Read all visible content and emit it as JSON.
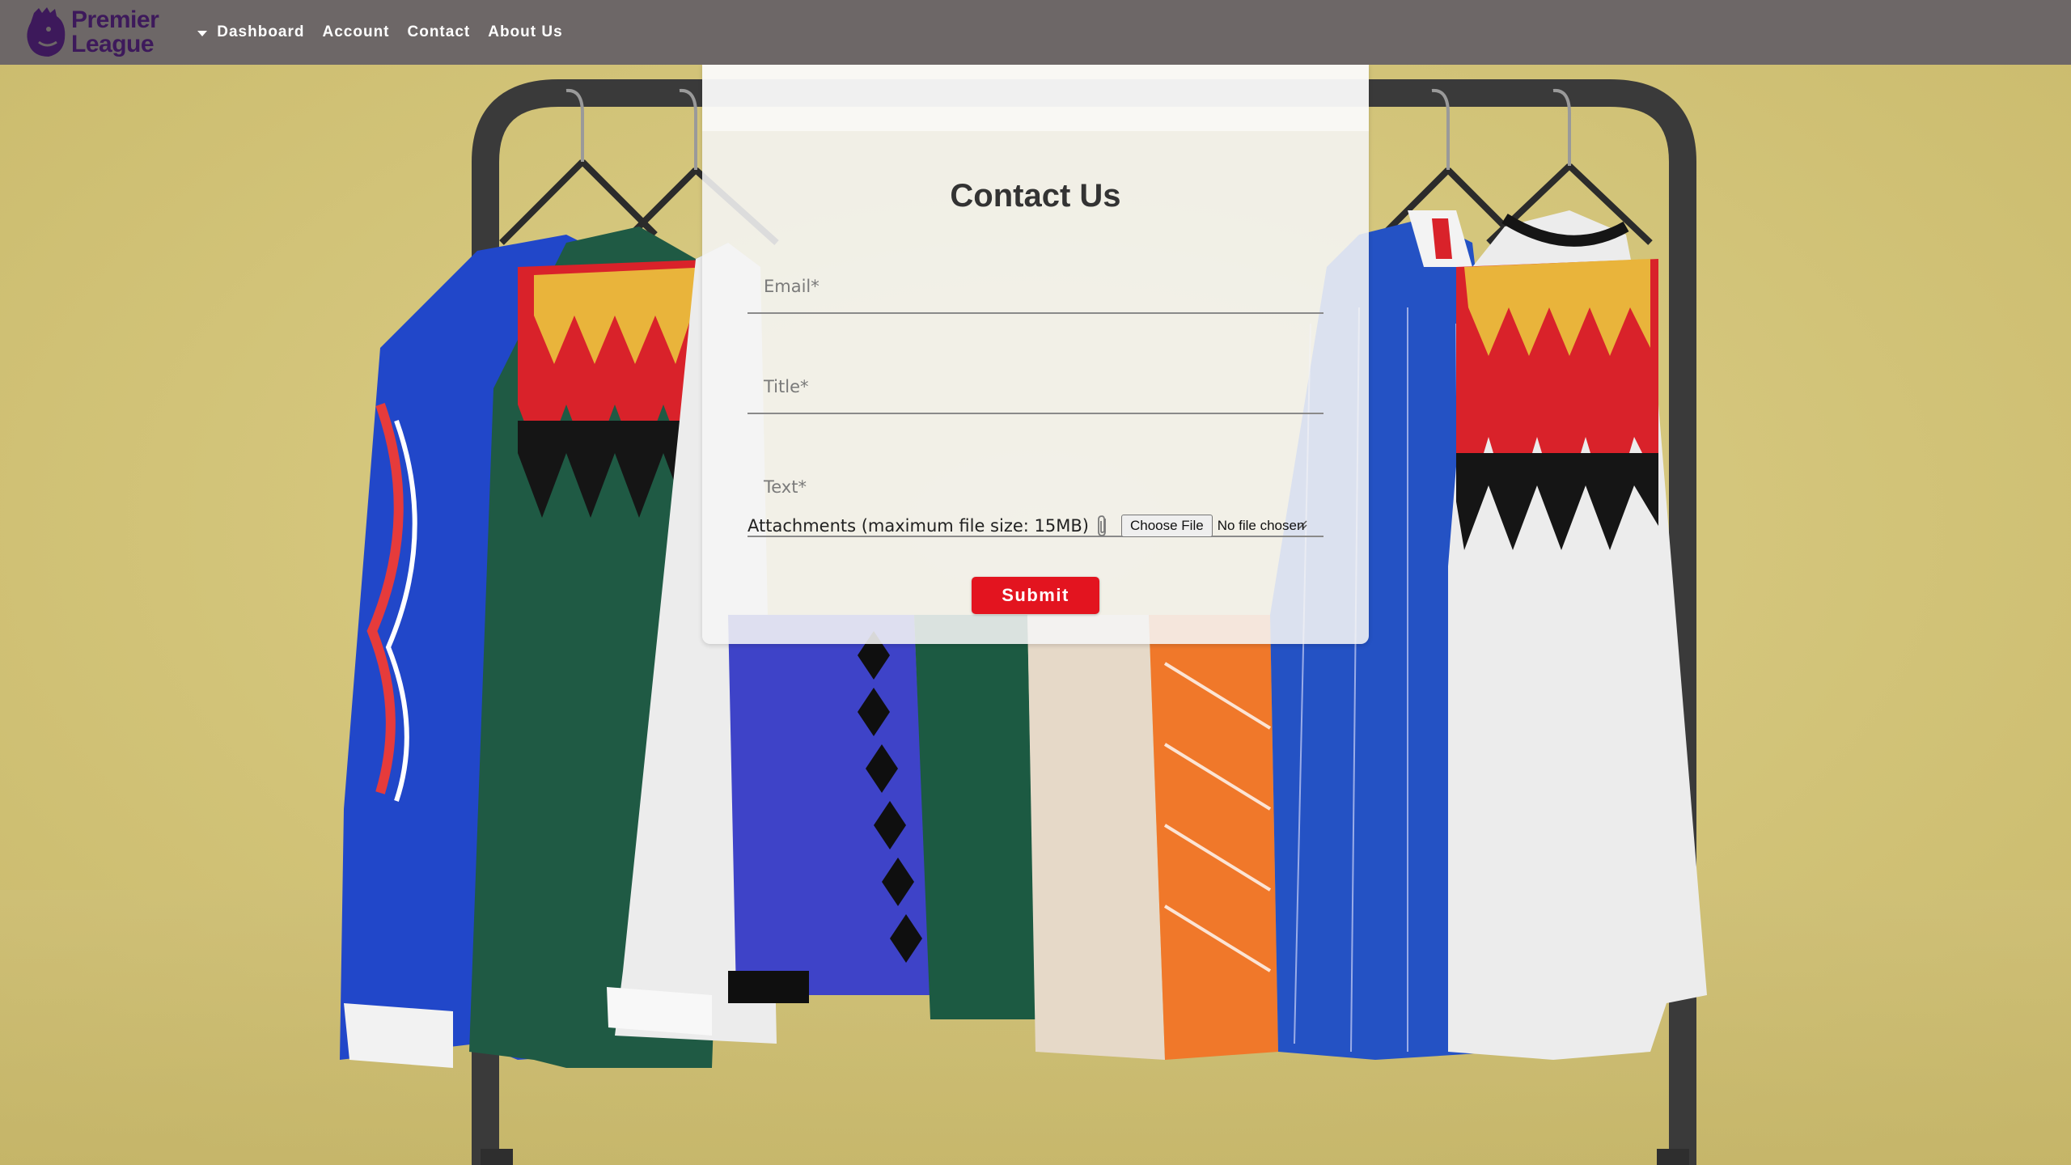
{
  "brand": {
    "logo_line1": "Premier",
    "logo_line2": "League",
    "color": "#3d195b"
  },
  "nav": {
    "items": [
      {
        "label": "Dashboard"
      },
      {
        "label": "Account"
      },
      {
        "label": "Contact"
      },
      {
        "label": "About Us"
      }
    ]
  },
  "contact_form": {
    "title": "Contact Us",
    "email_label": "Email*",
    "title_label": "Title*",
    "text_label": "Text*",
    "attachments_label": "Attachments (maximum file size: 15MB)",
    "choose_file_label": "Choose File",
    "no_file_label": "No file chosen",
    "submit_label": "Submit"
  },
  "colors": {
    "navbar": "#6d6767",
    "submit": "#e3141f",
    "background": "#d4c574"
  }
}
